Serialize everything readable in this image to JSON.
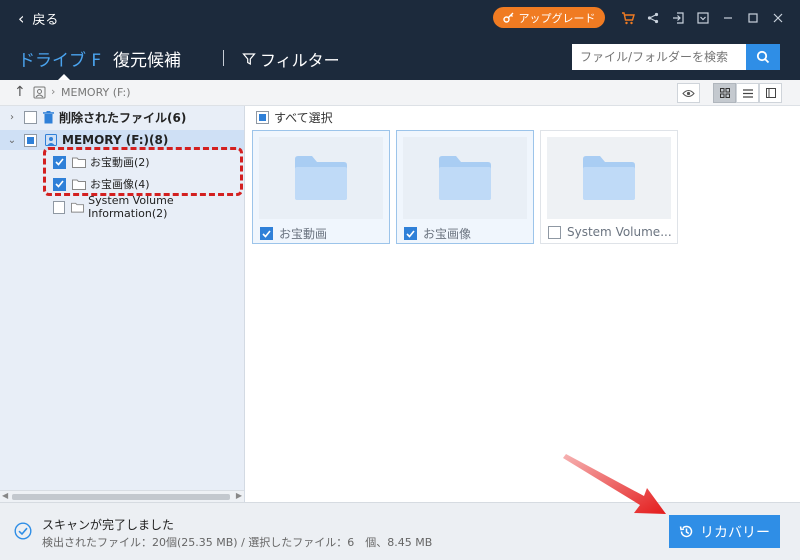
{
  "titlebar": {
    "back_label": "戻る",
    "upgrade_label": "アップグレード",
    "icons": [
      "cart-icon",
      "share-icon",
      "login-icon",
      "menu-icon",
      "minimize-icon",
      "maximize-icon",
      "close-icon"
    ]
  },
  "nav": {
    "drive_tab": "ドライブ F",
    "candidates_tab": "復元候補",
    "filter_label": "フィルター",
    "search_placeholder": "ファイル/フォルダーを検索"
  },
  "path": {
    "current": "MEMORY (F:)"
  },
  "tree": {
    "deleted_files": "削除されたファイル(6)",
    "memory_drive": "MEMORY (F:)(8)",
    "children": [
      {
        "label": "お宝動画(2)",
        "checked": true
      },
      {
        "label": "お宝画像(4)",
        "checked": true
      },
      {
        "label": "System Volume Information(2)",
        "checked": false
      }
    ]
  },
  "main": {
    "select_all_label": "すべて選択",
    "tiles": [
      {
        "name": "お宝動画",
        "checked": true
      },
      {
        "name": "お宝画像",
        "checked": true
      },
      {
        "name": "System Volume...",
        "checked": false
      }
    ]
  },
  "status": {
    "title": "スキャンが完了しました",
    "detail": "検出されたファイル：20個(25.35 MB) / 選択したファイル：6　個、8.45 MB"
  },
  "recover_label": "リカバリー",
  "colors": {
    "accent": "#2f8ee6",
    "upgrade": "#f07b22",
    "header": "#1c2a3c",
    "annotation": "#d32020"
  }
}
